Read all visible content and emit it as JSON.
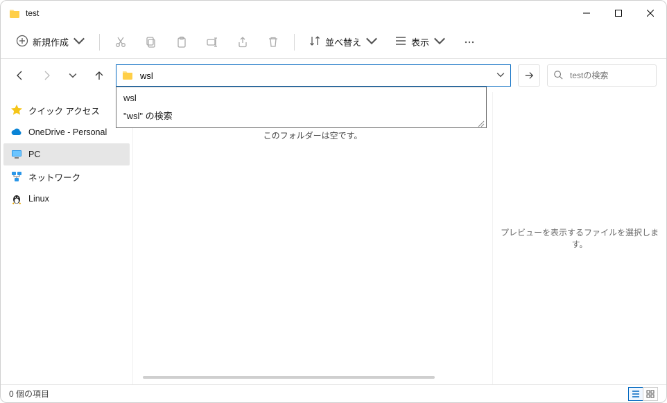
{
  "title": "test",
  "toolbar": {
    "new_label": "新規作成",
    "sort_label": "並べ替え",
    "view_label": "表示"
  },
  "addressbar": {
    "value": "wsl",
    "suggestions": {
      "row1": "wsl",
      "row2": "\"wsl\" の検索"
    }
  },
  "search": {
    "placeholder": "testの検索"
  },
  "nav": {
    "quick_access": "クイック アクセス",
    "onedrive": "OneDrive - Personal",
    "pc": "PC",
    "network": "ネットワーク",
    "linux": "Linux"
  },
  "content": {
    "empty": "このフォルダーは空です。"
  },
  "preview": {
    "text": "プレビューを表示するファイルを選択します。"
  },
  "status": {
    "count": "0 個の項目"
  }
}
